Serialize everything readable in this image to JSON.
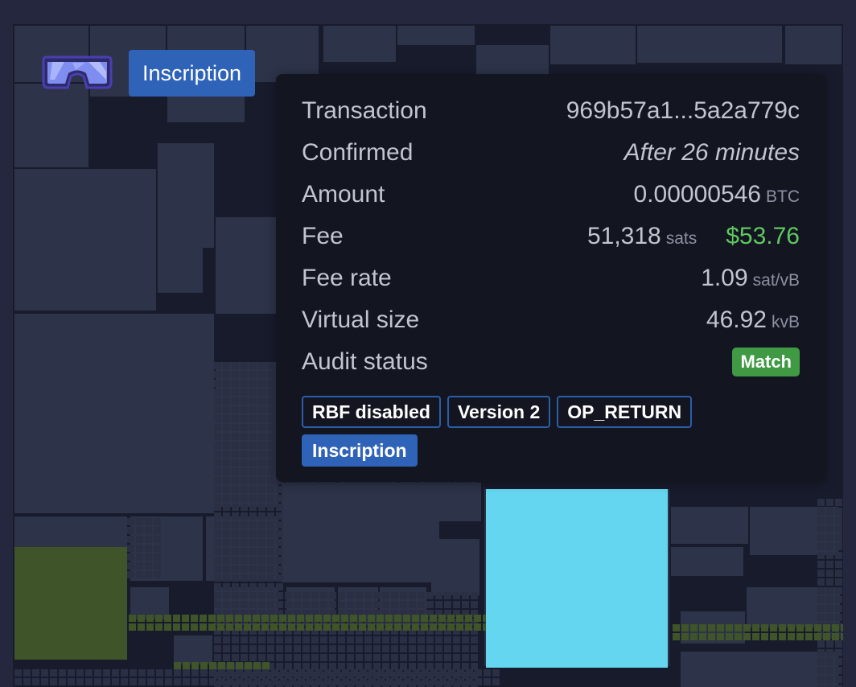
{
  "hover_label": {
    "icon": "inscription-glasses-icon",
    "badge": "Inscription"
  },
  "tooltip": {
    "rows": [
      {
        "label": "Transaction",
        "value": "969b57a1...5a2a779c"
      },
      {
        "label": "Confirmed",
        "value": "After 26 minutes"
      },
      {
        "label": "Amount",
        "value": "0.00000546",
        "unit": "BTC"
      },
      {
        "label": "Fee",
        "value": "51,318",
        "unit": "sats",
        "usd": "$53.76"
      },
      {
        "label": "Fee rate",
        "value": "1.09",
        "unit": "sat/vB"
      },
      {
        "label": "Virtual size",
        "value": "46.92",
        "unit": "kvB"
      },
      {
        "label": "Audit status",
        "badge": "Match"
      }
    ],
    "tags": [
      "RBF disabled",
      "Version 2",
      "OP_RETURN",
      "Inscription"
    ]
  },
  "colors": {
    "background": "#24273e",
    "tile": "#2d3348",
    "highlight_tile": "#64d6ef",
    "green_tile": "#3f5428",
    "txid_link": "#5ec4ea",
    "usd_value": "#5fc85f",
    "match_badge": "#3f9a43",
    "tag_blue": "#2f63b8"
  }
}
